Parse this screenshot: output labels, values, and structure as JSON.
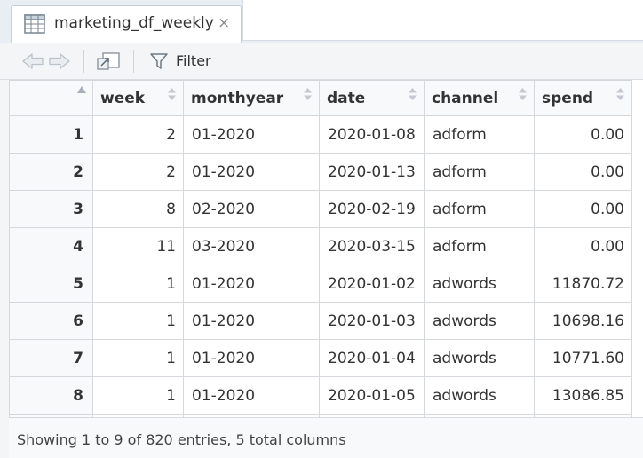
{
  "tab": {
    "title": "marketing_df_weekly",
    "close_glyph": "×",
    "icon": "table-grid-icon"
  },
  "toolbar": {
    "back_icon": "arrow-left-icon",
    "forward_icon": "arrow-right-icon",
    "popout_icon": "popout-window-icon",
    "filter_icon": "funnel-icon",
    "filter_label": "Filter"
  },
  "columns": [
    "week",
    "monthyear",
    "date",
    "channel",
    "spend"
  ],
  "rows": [
    {
      "n": "1",
      "week": "2",
      "monthyear": "01-2020",
      "date": "2020-01-08",
      "channel": "adform",
      "spend": "0.00"
    },
    {
      "n": "2",
      "week": "2",
      "monthyear": "01-2020",
      "date": "2020-01-13",
      "channel": "adform",
      "spend": "0.00"
    },
    {
      "n": "3",
      "week": "8",
      "monthyear": "02-2020",
      "date": "2020-02-19",
      "channel": "adform",
      "spend": "0.00"
    },
    {
      "n": "4",
      "week": "11",
      "monthyear": "03-2020",
      "date": "2020-03-15",
      "channel": "adform",
      "spend": "0.00"
    },
    {
      "n": "5",
      "week": "1",
      "monthyear": "01-2020",
      "date": "2020-01-02",
      "channel": "adwords",
      "spend": "11870.72"
    },
    {
      "n": "6",
      "week": "1",
      "monthyear": "01-2020",
      "date": "2020-01-03",
      "channel": "adwords",
      "spend": "10698.16"
    },
    {
      "n": "7",
      "week": "1",
      "monthyear": "01-2020",
      "date": "2020-01-04",
      "channel": "adwords",
      "spend": "10771.60"
    },
    {
      "n": "8",
      "week": "1",
      "monthyear": "01-2020",
      "date": "2020-01-05",
      "channel": "adwords",
      "spend": "13086.85"
    }
  ],
  "status": {
    "text": "Showing 1 to 9 of 820 entries, 5 total columns"
  },
  "colors": {
    "accent_bg": "#e8eef4",
    "header_bg": "#f8f9fa",
    "border": "#d5d9de"
  }
}
